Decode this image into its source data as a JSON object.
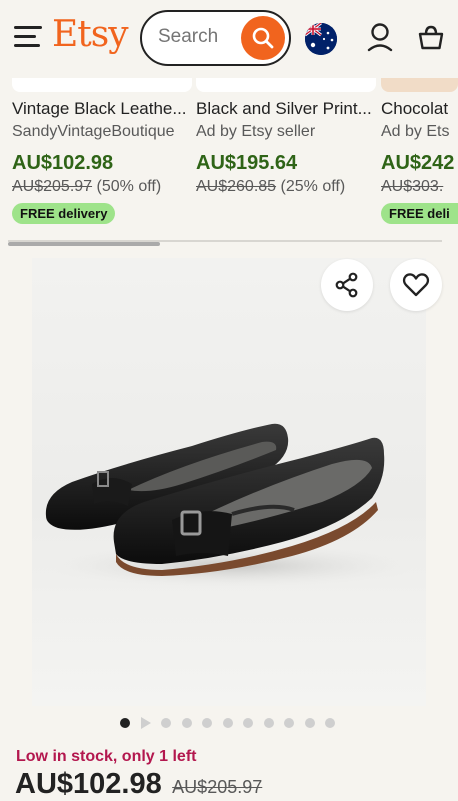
{
  "header": {
    "logo": "Etsy",
    "search_placeholder": "Search"
  },
  "recommendations": [
    {
      "title": "Vintage Black Leathe...",
      "shop": "SandyVintageBoutique",
      "price": "AU$102.98",
      "original_price": "AU$205.97",
      "discount": "(50% off)",
      "badge": "FREE delivery"
    },
    {
      "title": "Black and Silver Print...",
      "shop": "Ad by Etsy seller",
      "price": "AU$195.64",
      "original_price": "AU$260.85",
      "discount": "(25% off)",
      "badge": ""
    },
    {
      "title": "Chocolat",
      "shop": "Ad by Ets",
      "price": "AU$242",
      "original_price": "AU$303.",
      "discount": "",
      "badge": "FREE deli"
    }
  ],
  "product": {
    "image_count": 11,
    "active_image": 1,
    "stock_text": "Low in stock, only 1 left",
    "price": "AU$102.98",
    "original_price": "AU$205.97"
  },
  "colors": {
    "brand": "#f1641e",
    "price_green": "#2f6417",
    "badge_green": "#9ee38a",
    "stock_red": "#b3174e"
  },
  "icons": [
    "menu-icon",
    "search-icon",
    "australia-flag-icon",
    "user-icon",
    "cart-icon",
    "share-icon",
    "heart-icon",
    "play-icon"
  ]
}
